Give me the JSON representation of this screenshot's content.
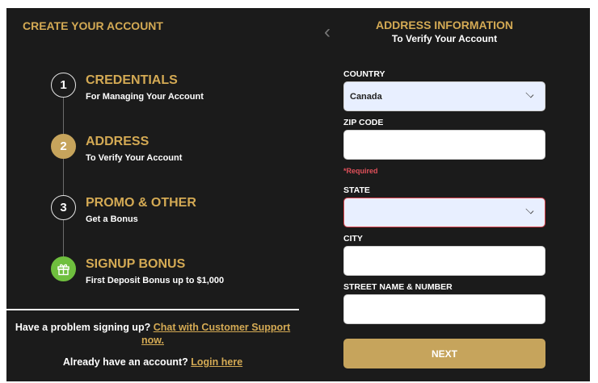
{
  "page": {
    "title": "CREATE YOUR ACCOUNT"
  },
  "steps": [
    {
      "marker": "1",
      "title": "CREDENTIALS",
      "subtitle": "For Managing Your Account",
      "state": "done"
    },
    {
      "marker": "2",
      "title": "ADDRESS",
      "subtitle": "To Verify Your Account",
      "state": "active"
    },
    {
      "marker": "3",
      "title": "PROMO & OTHER",
      "subtitle": "Get a Bonus",
      "state": "pending"
    },
    {
      "marker": "gift-icon",
      "title": "SIGNUP BONUS",
      "subtitle": "First Deposit Bonus up to $1,000",
      "state": "bonus"
    }
  ],
  "help": {
    "problem_text": "Have a problem signing up?",
    "support_link": "Chat with Customer Support now.",
    "account_text": "Already have an account?",
    "login_link": "Login here"
  },
  "form": {
    "back_icon": "chevron-left-icon",
    "title": "ADDRESS INFORMATION",
    "subtitle": "To Verify Your Account",
    "country": {
      "label": "COUNTRY",
      "value": "Canada"
    },
    "zip": {
      "label": "ZIP CODE",
      "value": "",
      "error": "*Required"
    },
    "state": {
      "label": "STATE",
      "value": ""
    },
    "city": {
      "label": "CITY",
      "value": ""
    },
    "street": {
      "label": "STREET NAME & NUMBER",
      "value": ""
    },
    "next_label": "NEXT"
  },
  "colors": {
    "background": "#1b1b1b",
    "accent_gold": "#d4aa54",
    "button_gold": "#c6a45c",
    "bonus_green": "#6fbf3e",
    "error_red": "#d9424a",
    "select_fill": "#e8efff"
  }
}
